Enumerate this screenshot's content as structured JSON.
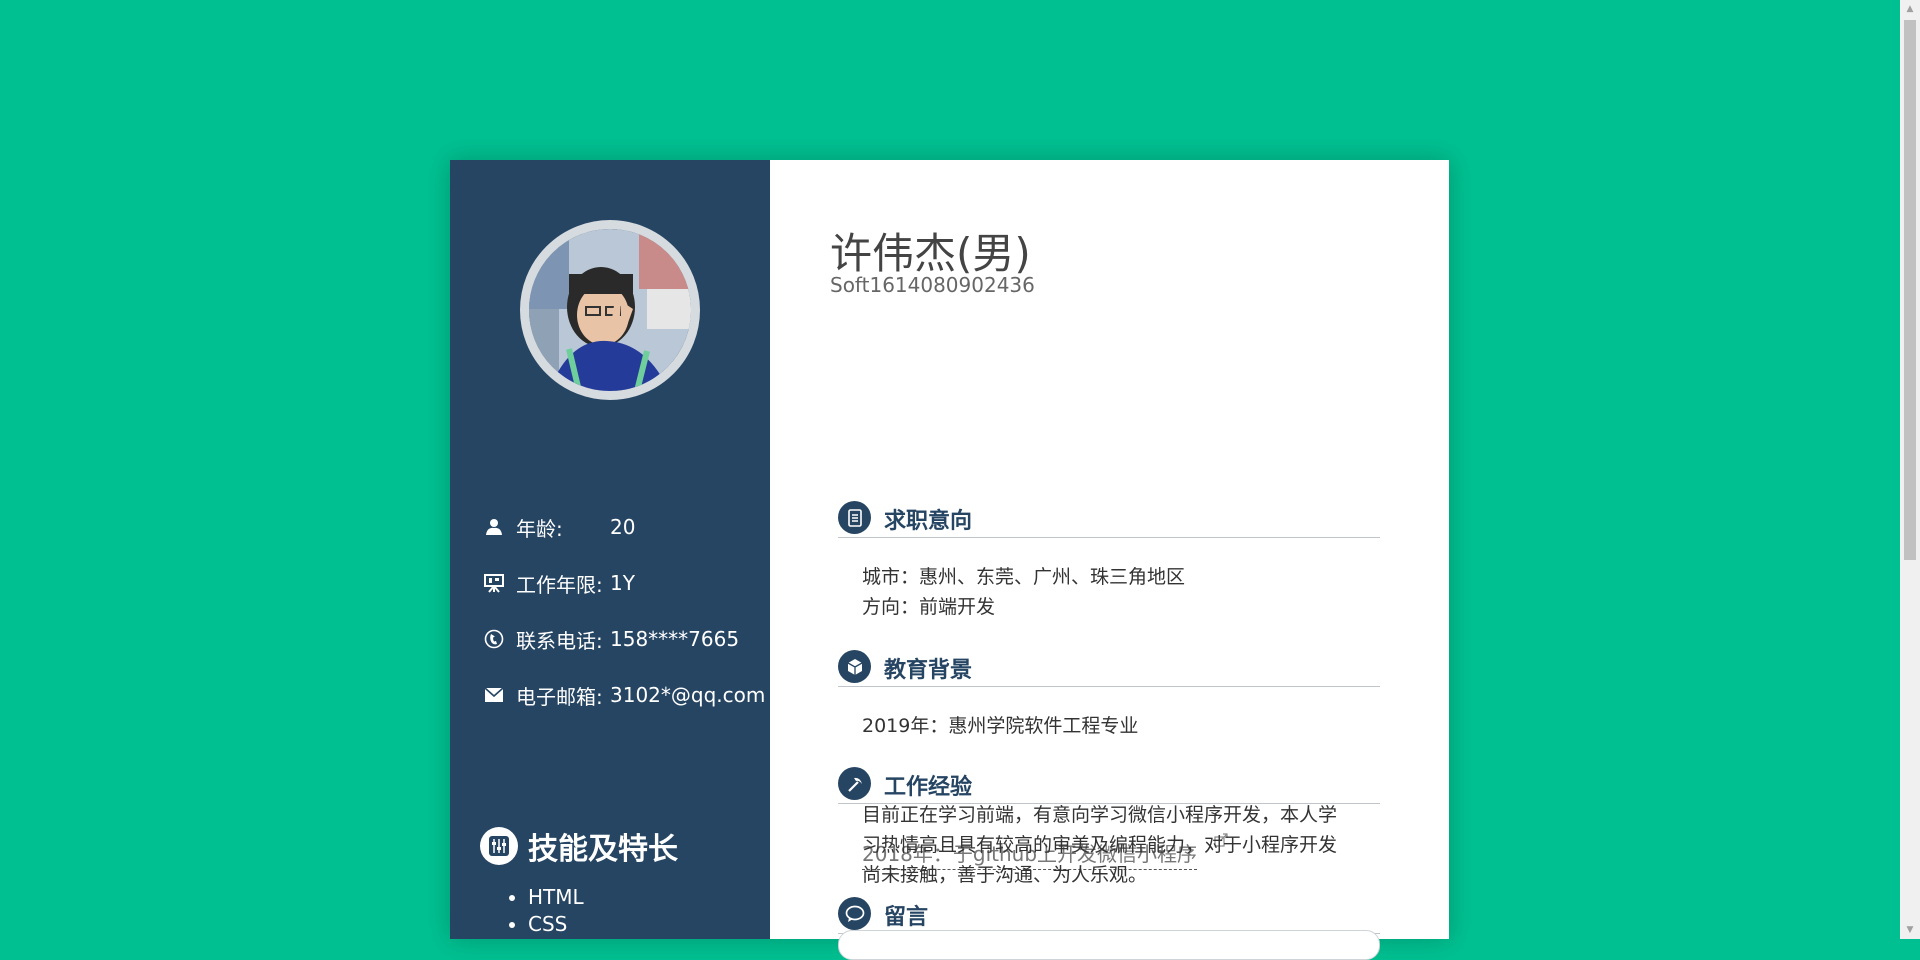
{
  "profile": {
    "name": "许伟杰(男)",
    "id": "Soft1614080902436"
  },
  "sidebar": {
    "info": [
      {
        "icon": "person-icon",
        "label": "年龄:",
        "value": "20"
      },
      {
        "icon": "presentation-icon",
        "label": "工作年限:",
        "value": "1Y"
      },
      {
        "icon": "phone-icon",
        "label": "联系电话:",
        "value": "158****7665"
      },
      {
        "icon": "mail-icon",
        "label": "电子邮箱:",
        "value": "3102*@qq.com"
      }
    ],
    "skills_title": "技能及特长",
    "skills": [
      "HTML",
      "CSS"
    ]
  },
  "sections": {
    "intent": {
      "title": "求职意向",
      "lines": [
        "城市：惠州、东莞、广州、珠三角地区",
        "方向：前端开发"
      ]
    },
    "education": {
      "title": "教育背景",
      "lines": [
        "2019年：惠州学院软件工程专业"
      ]
    },
    "work": {
      "title": "工作经验",
      "link_text": "2018年：于github上开发微信小程序"
    },
    "message": {
      "title": "留言",
      "text": "目前正在学习前端，有意向学习微信小程序开发，本人学习热情高且具有较高的审美及编程能力，对于小程序开发尚未接触，善于沟通、为人乐观。"
    }
  },
  "colors": {
    "background": "#00c091",
    "sidebar": "#264563",
    "accent": "#264563"
  }
}
